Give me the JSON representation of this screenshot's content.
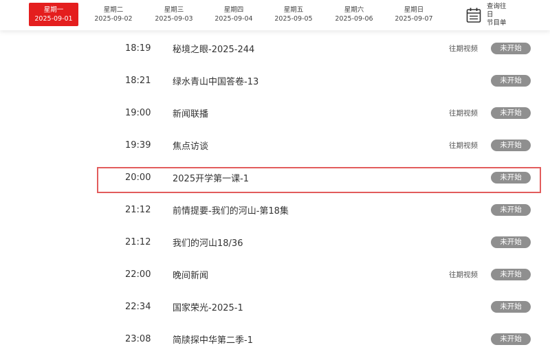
{
  "days": [
    {
      "weekday": "星期一",
      "date": "2025-09-01",
      "active": true
    },
    {
      "weekday": "星期二",
      "date": "2025-09-02",
      "active": false
    },
    {
      "weekday": "星期三",
      "date": "2025-09-03",
      "active": false
    },
    {
      "weekday": "星期四",
      "date": "2025-09-04",
      "active": false
    },
    {
      "weekday": "星期五",
      "date": "2025-09-05",
      "active": false
    },
    {
      "weekday": "星期六",
      "date": "2025-09-06",
      "active": false
    },
    {
      "weekday": "星期日",
      "date": "2025-09-07",
      "active": false
    }
  ],
  "history": {
    "line1": "查询往日",
    "line2": "节目单",
    "icon": "calendar-icon"
  },
  "programs": [
    {
      "time": "18:19",
      "title": "秘境之眼-2025-244",
      "replay": "往期视频",
      "status": "未开始"
    },
    {
      "time": "18:21",
      "title": "绿水青山中国答卷-13",
      "replay": "",
      "status": "未开始"
    },
    {
      "time": "19:00",
      "title": "新闻联播",
      "replay": "往期视频",
      "status": "未开始"
    },
    {
      "time": "19:39",
      "title": "焦点访谈",
      "replay": "往期视频",
      "status": "未开始"
    },
    {
      "time": "20:00",
      "title": "2025开学第一课-1",
      "replay": "",
      "status": "未开始",
      "highlighted": true
    },
    {
      "time": "21:12",
      "title": "前情提要-我们的河山-第18集",
      "replay": "",
      "status": "未开始"
    },
    {
      "time": "21:12",
      "title": "我们的河山18/36",
      "replay": "",
      "status": "未开始"
    },
    {
      "time": "22:00",
      "title": "晚间新闻",
      "replay": "往期视频",
      "status": "未开始"
    },
    {
      "time": "22:34",
      "title": "国家荣光-2025-1",
      "replay": "",
      "status": "未开始"
    },
    {
      "time": "23:08",
      "title": "简牍探中华第二季-1",
      "replay": "",
      "status": "未开始"
    }
  ],
  "colors": {
    "active_tab": "#e41e1e",
    "status_badge": "#8f8f8f",
    "highlight_border": "#e25c5c"
  }
}
